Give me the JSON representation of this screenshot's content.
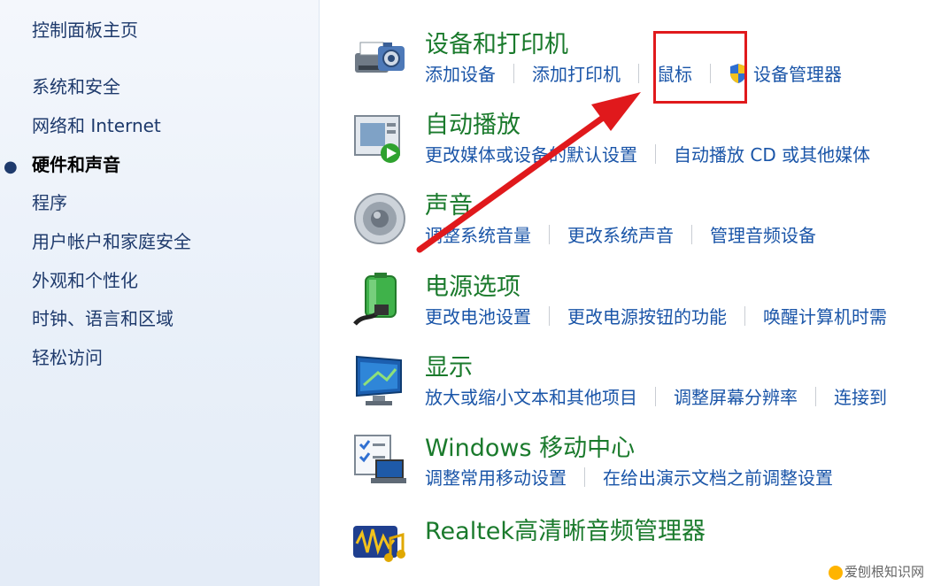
{
  "sidebar": {
    "home": "控制面板主页",
    "items": [
      {
        "label": "系统和安全",
        "active": false
      },
      {
        "label": "网络和 Internet",
        "active": false
      },
      {
        "label": "硬件和声音",
        "active": true
      },
      {
        "label": "程序",
        "active": false
      },
      {
        "label": "用户帐户和家庭安全",
        "active": false
      },
      {
        "label": "外观和个性化",
        "active": false
      },
      {
        "label": "时钟、语言和区域",
        "active": false
      },
      {
        "label": "轻松访问",
        "active": false
      }
    ]
  },
  "categories": [
    {
      "title": "设备和打印机",
      "icon": "printer-camera-icon",
      "links": [
        "添加设备",
        "添加打印机",
        "鼠标",
        "设备管理器"
      ]
    },
    {
      "title": "自动播放",
      "icon": "autoplay-icon",
      "links": [
        "更改媒体或设备的默认设置",
        "自动播放 CD 或其他媒体"
      ]
    },
    {
      "title": "声音",
      "icon": "speaker-icon",
      "links": [
        "调整系统音量",
        "更改系统声音",
        "管理音频设备"
      ]
    },
    {
      "title": "电源选项",
      "icon": "battery-plug-icon",
      "links": [
        "更改电池设置",
        "更改电源按钮的功能",
        "唤醒计算机时需"
      ]
    },
    {
      "title": "显示",
      "icon": "monitor-icon",
      "links": [
        "放大或缩小文本和其他项目",
        "调整屏幕分辨率",
        "连接到"
      ]
    },
    {
      "title": "Windows 移动中心",
      "icon": "mobility-center-icon",
      "links": [
        "调整常用移动设置",
        "在给出演示文档之前调整设置"
      ]
    },
    {
      "title": "Realtek高清晰音频管理器",
      "icon": "realtek-audio-icon",
      "links": []
    }
  ],
  "annotation_color": "#e0191c",
  "watermark": "爱刨根知识网"
}
